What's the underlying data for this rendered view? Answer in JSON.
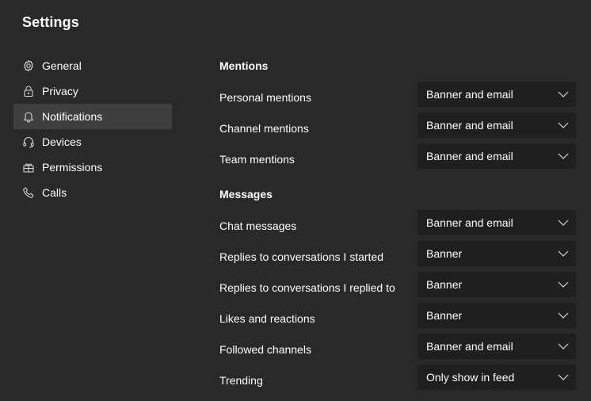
{
  "app": {
    "title": "Settings"
  },
  "sidebar": {
    "items": [
      {
        "label": "General",
        "icon": "gear-icon"
      },
      {
        "label": "Privacy",
        "icon": "lock-icon"
      },
      {
        "label": "Notifications",
        "icon": "bell-icon",
        "active": true
      },
      {
        "label": "Devices",
        "icon": "headset-icon"
      },
      {
        "label": "Permissions",
        "icon": "gift-box-icon"
      },
      {
        "label": "Calls",
        "icon": "phone-icon"
      }
    ]
  },
  "main": {
    "mentions": {
      "title": "Mentions",
      "rows": [
        {
          "label": "Personal mentions",
          "value": "Banner and email"
        },
        {
          "label": "Channel mentions",
          "value": "Banner and email"
        },
        {
          "label": "Team mentions",
          "value": "Banner and email"
        }
      ]
    },
    "messages": {
      "title": "Messages",
      "rows": [
        {
          "label": "Chat messages",
          "value": "Banner and email"
        },
        {
          "label": "Replies to conversations I started",
          "value": "Banner"
        },
        {
          "label": "Replies to conversations I replied to",
          "value": "Banner"
        },
        {
          "label": "Likes and reactions",
          "value": "Banner"
        },
        {
          "label": "Followed channels",
          "value": "Banner and email"
        },
        {
          "label": "Trending",
          "value": "Only show in feed"
        }
      ]
    }
  },
  "colors": {
    "background": "#292929",
    "active_item": "#3f3f3f",
    "dropdown_bg": "#1f1f1f",
    "text": "#ffffff"
  }
}
